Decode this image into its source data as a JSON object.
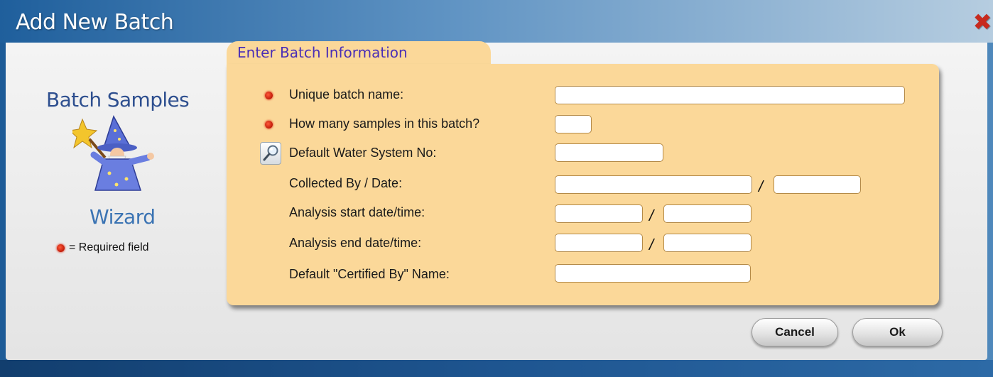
{
  "window": {
    "title": "Add New Batch",
    "close_icon": "close-x-icon"
  },
  "sidebar": {
    "title": "Batch Samples",
    "subtitle": "Wizard",
    "image": "wizard-icon",
    "legend_icon": "required-dot-icon",
    "legend_text": "= Required field"
  },
  "form": {
    "tab_label": "Enter Batch Information",
    "fields": [
      {
        "label": "Unique batch name:",
        "required": true,
        "value": ""
      },
      {
        "label": "How many samples in this batch?",
        "required": true,
        "value": ""
      },
      {
        "label": "Default Water System No:",
        "required": false,
        "value": "",
        "lookup_icon": "magnifier-icon"
      },
      {
        "label": "Collected By / Date:",
        "required": false,
        "values": [
          "",
          ""
        ],
        "separator": "/"
      },
      {
        "label": "Analysis start date/time:",
        "required": false,
        "values": [
          "",
          ""
        ],
        "separator": "/"
      },
      {
        "label": "Analysis end date/time:",
        "required": false,
        "values": [
          "",
          ""
        ],
        "separator": "/"
      },
      {
        "label": "Default \"Certified By\" Name:",
        "required": false,
        "value": ""
      }
    ]
  },
  "buttons": {
    "cancel": "Cancel",
    "ok": "Ok"
  },
  "colors": {
    "panel": "#fbd899",
    "tab_text": "#4a2fb6",
    "required_marker": "#d9261a",
    "title_bar": "#2a6eaa"
  }
}
